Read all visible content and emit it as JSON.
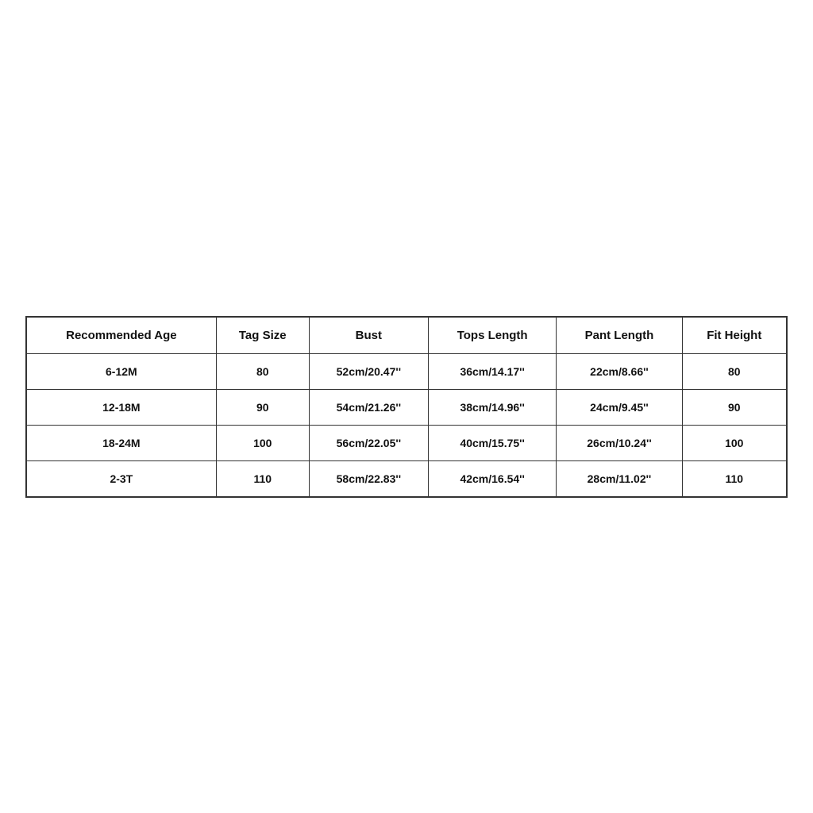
{
  "table": {
    "headers": [
      "Recommended Age",
      "Tag Size",
      "Bust",
      "Tops Length",
      "Pant Length",
      "Fit Height"
    ],
    "rows": [
      {
        "age": "6-12M",
        "tag_size": "80",
        "bust": "52cm/20.47''",
        "tops_length": "36cm/14.17''",
        "pant_length": "22cm/8.66''",
        "fit_height": "80"
      },
      {
        "age": "12-18M",
        "tag_size": "90",
        "bust": "54cm/21.26''",
        "tops_length": "38cm/14.96''",
        "pant_length": "24cm/9.45''",
        "fit_height": "90"
      },
      {
        "age": "18-24M",
        "tag_size": "100",
        "bust": "56cm/22.05''",
        "tops_length": "40cm/15.75''",
        "pant_length": "26cm/10.24''",
        "fit_height": "100"
      },
      {
        "age": "2-3T",
        "tag_size": "110",
        "bust": "58cm/22.83''",
        "tops_length": "42cm/16.54''",
        "pant_length": "28cm/11.02''",
        "fit_height": "110"
      }
    ]
  }
}
